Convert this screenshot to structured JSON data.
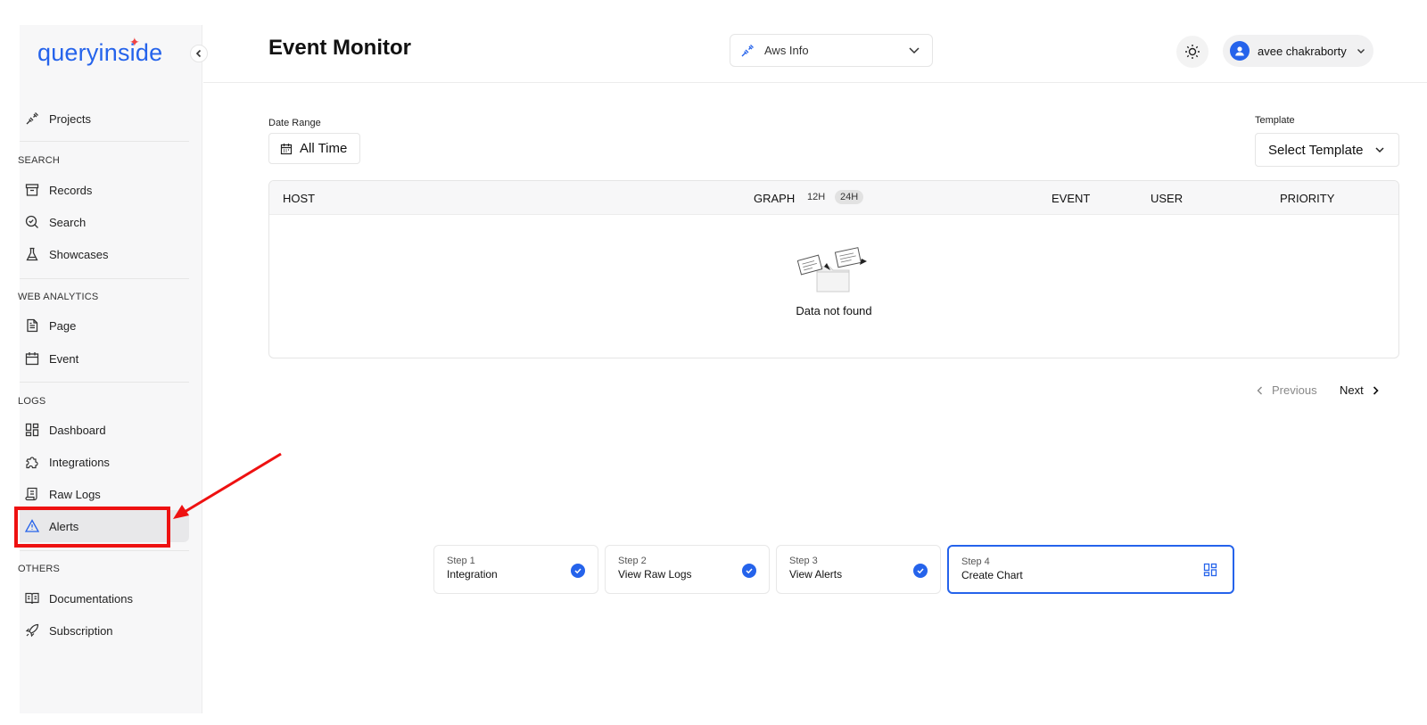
{
  "app": {
    "logo_text": "queryinside",
    "colors": {
      "accent": "#2563eb",
      "annotation": "#ee1111"
    }
  },
  "sidebar": {
    "items_top": [
      {
        "label": "Projects",
        "icon": "plug-icon"
      }
    ],
    "sections": [
      {
        "label": "SEARCH",
        "items": [
          {
            "label": "Records",
            "icon": "archive-icon"
          },
          {
            "label": "Search",
            "icon": "search-check-icon"
          },
          {
            "label": "Showcases",
            "icon": "flask-icon"
          }
        ]
      },
      {
        "label": "WEB ANALYTICS",
        "items": [
          {
            "label": "Page",
            "icon": "file-text-icon"
          },
          {
            "label": "Event",
            "icon": "calendar-icon"
          }
        ]
      },
      {
        "label": "LOGS",
        "items": [
          {
            "label": "Dashboard",
            "icon": "dashboard-icon"
          },
          {
            "label": "Integrations",
            "icon": "puzzle-icon"
          },
          {
            "label": "Raw Logs",
            "icon": "scroll-icon"
          },
          {
            "label": "Alerts",
            "icon": "alert-triangle-icon",
            "active": true
          }
        ]
      },
      {
        "label": "OTHERS",
        "items": [
          {
            "label": "Documentations",
            "icon": "book-icon"
          },
          {
            "label": "Subscription",
            "icon": "rocket-icon"
          }
        ]
      }
    ]
  },
  "header": {
    "title": "Event Monitor",
    "project_select": "Aws Info",
    "user_name": "avee chakraborty"
  },
  "filters": {
    "date_range_label": "Date Range",
    "date_range_value": "All Time",
    "template_label": "Template",
    "template_value": "Select Template"
  },
  "table": {
    "columns": {
      "host": "HOST",
      "graph": "GRAPH",
      "event": "EVENT",
      "user": "USER",
      "priority": "PRIORITY"
    },
    "graph_toggle": [
      "12H",
      "24H"
    ],
    "graph_toggle_selected": "24H",
    "empty_text": "Data not found"
  },
  "pagination": {
    "previous": "Previous",
    "next": "Next"
  },
  "steps": [
    {
      "step": "Step 1",
      "label": "Integration",
      "done": true
    },
    {
      "step": "Step 2",
      "label": "View Raw Logs",
      "done": true
    },
    {
      "step": "Step 3",
      "label": "View Alerts",
      "done": true
    },
    {
      "step": "Step 4",
      "label": "Create Chart",
      "done": false,
      "current": true
    }
  ]
}
